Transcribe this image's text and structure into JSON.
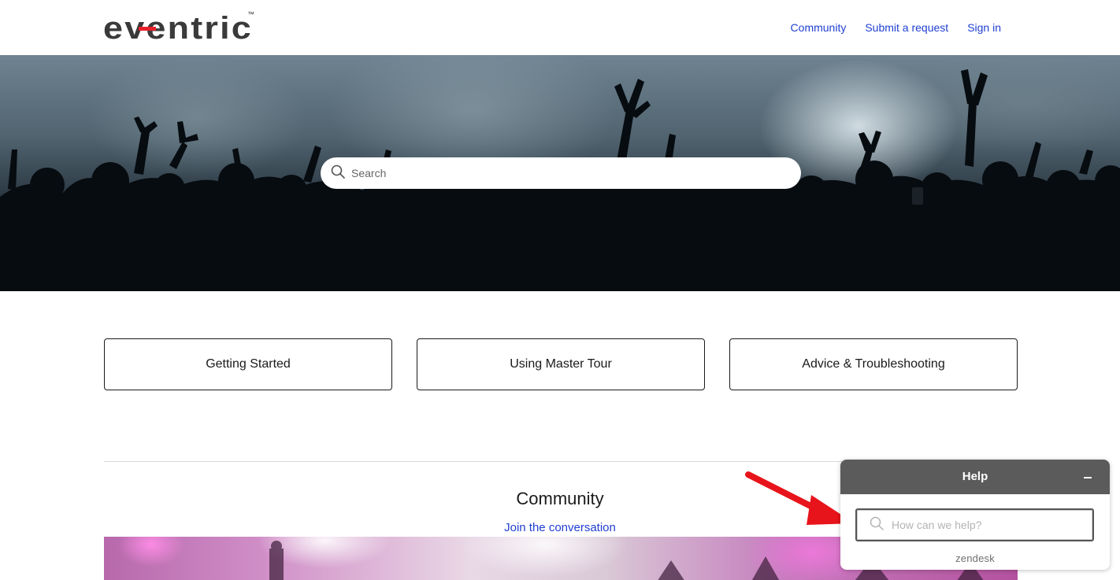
{
  "brand": {
    "logo_text": "eventric",
    "trademark": "™",
    "logo_accent_color": "#e8202a"
  },
  "nav": {
    "items": [
      {
        "label": "Community"
      },
      {
        "label": "Submit a request"
      },
      {
        "label": "Sign in"
      }
    ],
    "link_color": "#1f3fd1"
  },
  "hero": {
    "search": {
      "placeholder": "Search",
      "icon": "search-icon"
    }
  },
  "categories": [
    {
      "label": "Getting Started"
    },
    {
      "label": "Using Master Tour"
    },
    {
      "label": "Advice & Troubleshooting"
    }
  ],
  "community": {
    "title": "Community",
    "link_label": "Join the conversation"
  },
  "help_widget": {
    "title": "Help",
    "minimize_icon": "minimize-icon",
    "search_placeholder": "How can we help?",
    "brand": "zendesk",
    "header_color": "#5b5b5b"
  },
  "annotation": {
    "arrow_color": "#e8141b",
    "arrow_icon": "red-arrow-annotation"
  }
}
